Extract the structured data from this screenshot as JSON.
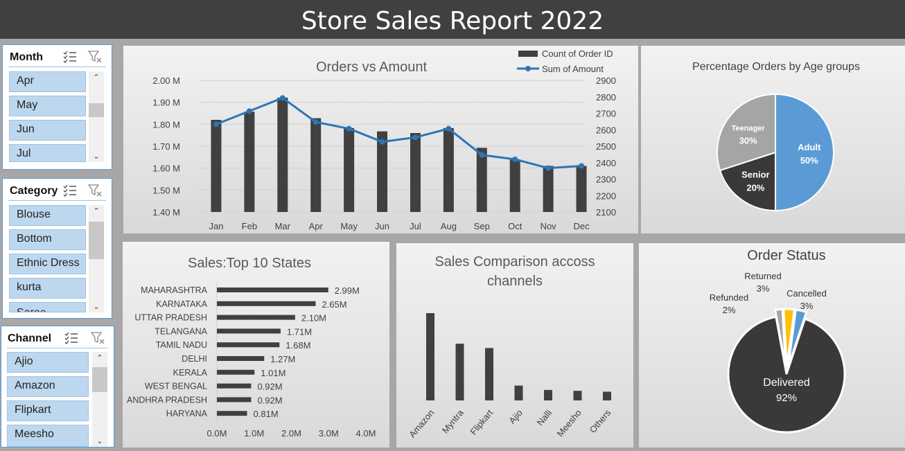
{
  "report_title": "Store Sales Report 2022",
  "slicers": {
    "month": {
      "title": "Month",
      "items": [
        "Apr",
        "May",
        "Jun",
        "Jul"
      ]
    },
    "category": {
      "title": "Category",
      "items": [
        "Blouse",
        "Bottom",
        "Ethnic Dress",
        "kurta",
        "Saree"
      ]
    },
    "channel": {
      "title": "Channel",
      "items": [
        "Ajio",
        "Amazon",
        "Flipkart",
        "Meesho"
      ]
    }
  },
  "chart_data": [
    {
      "type": "bar",
      "title": "Orders vs Amount",
      "categories": [
        "Jan",
        "Feb",
        "Mar",
        "Apr",
        "May",
        "Jun",
        "Jul",
        "Aug",
        "Sep",
        "Oct",
        "Nov",
        "Dec"
      ],
      "series": [
        {
          "name": "Count of Order ID",
          "kind": "bar",
          "axis": "right",
          "color": "#404040",
          "values": [
            2660,
            2710,
            2795,
            2670,
            2610,
            2590,
            2580,
            2610,
            2490,
            2420,
            2380,
            2380
          ]
        },
        {
          "name": "Sum of Amount",
          "kind": "line",
          "axis": "left",
          "color": "#2e75b6",
          "values": [
            1.8,
            1.86,
            1.92,
            1.81,
            1.78,
            1.72,
            1.74,
            1.78,
            1.66,
            1.64,
            1.6,
            1.61
          ]
        }
      ],
      "y_left_ticks": [
        "2.00 M",
        "1.90 M",
        "1.80 M",
        "1.70 M",
        "1.60 M",
        "1.50 M",
        "1.40 M"
      ],
      "y_left_range": [
        1.4,
        2.0
      ],
      "y_right_ticks": [
        "2900",
        "2800",
        "2700",
        "2600",
        "2500",
        "2400",
        "2300",
        "2200",
        "2100"
      ],
      "y_right_range": [
        2100,
        2900
      ],
      "legend_position": "top-right",
      "grid": true
    },
    {
      "type": "pie",
      "title": "Percentage Orders by Age groups",
      "slices": [
        {
          "name": "Adult",
          "value": 50,
          "label": "50%",
          "color": "#5b9bd5"
        },
        {
          "name": "Senior",
          "value": 20,
          "label": "20%",
          "color": "#3a3838"
        },
        {
          "name": "Teenager",
          "value": 30,
          "label": "30%",
          "color": "#a5a5a5"
        }
      ]
    },
    {
      "type": "bar",
      "orientation": "horizontal",
      "title": "Sales:Top 10 States",
      "categories": [
        "MAHARASHTRA",
        "KARNATAKA",
        "UTTAR PRADESH",
        "TELANGANA",
        "TAMIL NADU",
        "DELHI",
        "KERALA",
        "WEST BENGAL",
        "ANDHRA PRADESH",
        "HARYANA"
      ],
      "values": [
        2.99,
        2.65,
        2.1,
        1.71,
        1.68,
        1.27,
        1.01,
        0.92,
        0.92,
        0.81
      ],
      "value_labels": [
        "2.99M",
        "2.65M",
        "2.10M",
        "1.71M",
        "1.68M",
        "1.27M",
        "1.01M",
        "0.92M",
        "0.92M",
        "0.81M"
      ],
      "x_ticks": [
        "0.0M",
        "1.0M",
        "2.0M",
        "3.0M",
        "4.0M"
      ],
      "xlim": [
        0,
        4
      ],
      "color": "#404040"
    },
    {
      "type": "bar",
      "title": "Sales Comparison accoss channels",
      "title_lines": [
        "Sales Comparison accoss",
        "channels"
      ],
      "categories": [
        "Amazon",
        "Myntra",
        "Flipkart",
        "Ajio",
        "Nalli",
        "Meesho",
        "Others"
      ],
      "values": [
        100,
        65,
        60,
        17,
        12,
        11,
        10
      ],
      "color": "#404040"
    },
    {
      "type": "pie",
      "title": "Order Status",
      "slices": [
        {
          "name": "Delivered",
          "value": 92,
          "label": "92%",
          "color": "#3a3838"
        },
        {
          "name": "Refunded",
          "value": 2,
          "label": "2%",
          "color": "#a5a5a5"
        },
        {
          "name": "Returned",
          "value": 3,
          "label": "3%",
          "color": "#ffc000"
        },
        {
          "name": "Cancelled",
          "value": 3,
          "label": "3%",
          "color": "#5b9bd5"
        }
      ]
    }
  ]
}
